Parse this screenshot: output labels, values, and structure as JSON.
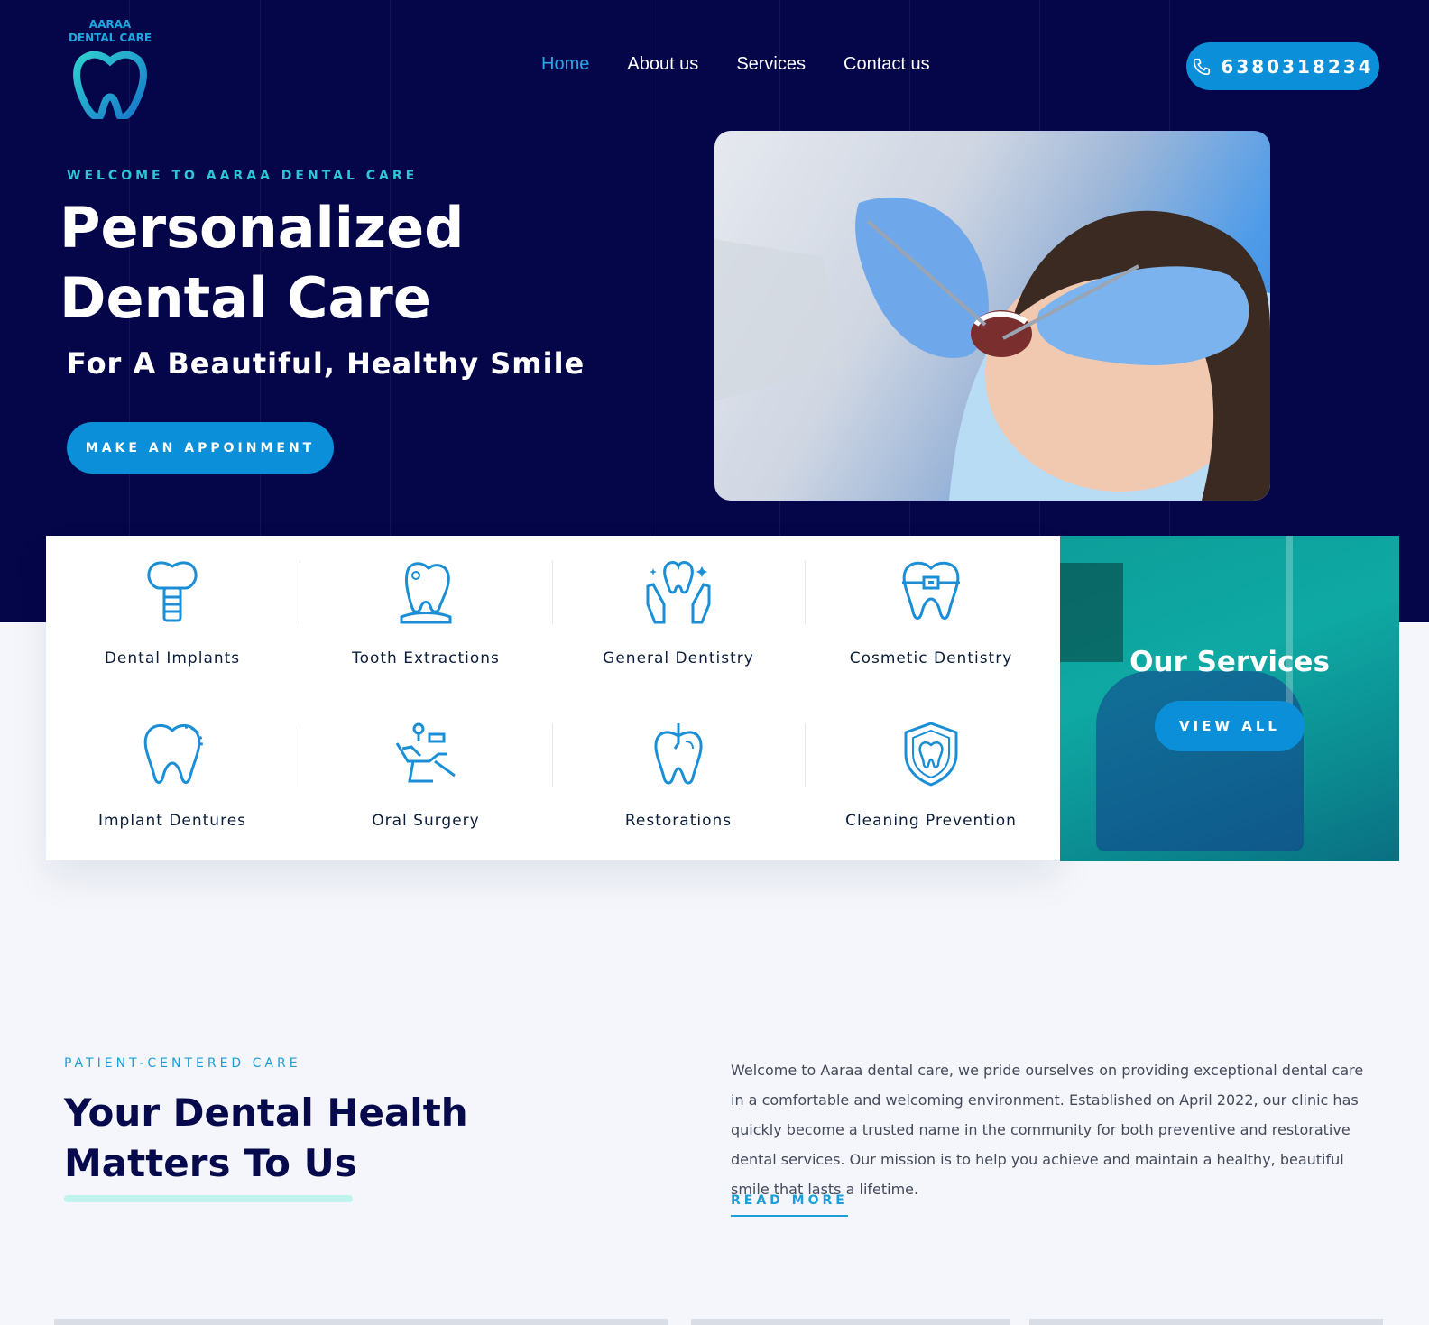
{
  "header": {
    "logo_line1": "AARAA",
    "logo_line2": "DENTAL CARE",
    "nav": [
      {
        "label": "Home",
        "active": true
      },
      {
        "label": "About us",
        "active": false
      },
      {
        "label": "Services",
        "active": false
      },
      {
        "label": "Contact us",
        "active": false
      }
    ],
    "phone": "6380318234"
  },
  "hero": {
    "welcome": "WELCOME TO AARAA DENTAL CARE",
    "title_line1": "Personalized",
    "title_line2": "Dental Care",
    "tagline": "For A Beautiful, Healthy Smile",
    "cta": "MAKE AN APPOINMENT"
  },
  "services": {
    "items": [
      {
        "label": "Dental Implants",
        "icon": "dental-implant-icon"
      },
      {
        "label": "Tooth Extractions",
        "icon": "tooth-extraction-icon"
      },
      {
        "label": "General Dentistry",
        "icon": "hands-tooth-icon"
      },
      {
        "label": "Cosmetic Dentistry",
        "icon": "tooth-braces-icon"
      },
      {
        "label": "Implant Dentures",
        "icon": "tooth-dashed-icon"
      },
      {
        "label": "Oral Surgery",
        "icon": "dental-chair-icon"
      },
      {
        "label": "Restorations",
        "icon": "tooth-restoration-icon"
      },
      {
        "label": "Cleaning Prevention",
        "icon": "tooth-shield-icon"
      }
    ],
    "panel_title": "Our Services",
    "panel_button": "VIEW ALL"
  },
  "about": {
    "eyebrow": "PATIENT-CENTERED CARE",
    "title_line1": "Your Dental Health",
    "title_line2": "Matters To Us",
    "paragraph": "Welcome to Aaraa dental care, we pride ourselves on providing exceptional dental care in a comfortable and welcoming environment. Established on April 2022, our clinic has quickly become a trusted name in the community for both preventive and restorative dental services. Our mission is to help you achieve and maintain a healthy, beautiful smile that lasts a lifetime.",
    "read_more": "READ MORE"
  },
  "colors": {
    "navy": "#05064a",
    "accent": "#0b8fd8",
    "teal": "#2ec6d6"
  }
}
